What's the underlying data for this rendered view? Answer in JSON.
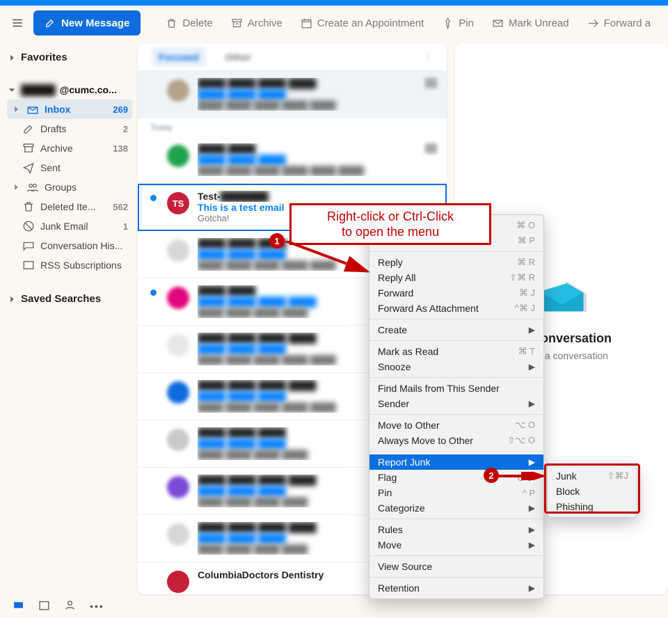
{
  "toolbar": {
    "new_message": "New Message",
    "buttons": [
      {
        "id": "delete",
        "label": "Delete"
      },
      {
        "id": "archive",
        "label": "Archive"
      },
      {
        "id": "appointment",
        "label": "Create an Appointment"
      },
      {
        "id": "pin",
        "label": "Pin"
      },
      {
        "id": "unread",
        "label": "Mark Unread"
      },
      {
        "id": "forward",
        "label": "Forward a"
      }
    ]
  },
  "sidebar": {
    "favorites": "Favorites",
    "saved_searches": "Saved Searches",
    "account": {
      "prefix_blur": "█████",
      "suffix": "@cumc.co..."
    },
    "folders": [
      {
        "id": "inbox",
        "label": "Inbox",
        "count": "269",
        "selected": true,
        "expandable": true
      },
      {
        "id": "drafts",
        "label": "Drafts",
        "count": "2"
      },
      {
        "id": "archive",
        "label": "Archive",
        "count": "138"
      },
      {
        "id": "sent",
        "label": "Sent"
      },
      {
        "id": "groups",
        "label": "Groups",
        "expandable": true
      },
      {
        "id": "deleted",
        "label": "Deleted Ite...",
        "count": "562"
      },
      {
        "id": "junk",
        "label": "Junk Email",
        "count": "1"
      },
      {
        "id": "convhist",
        "label": "Conversation His..."
      },
      {
        "id": "rss",
        "label": "RSS Subscriptions"
      }
    ]
  },
  "list_filters": {
    "active": "Focused",
    "other": "Other",
    "menu": "⋮"
  },
  "list_section_today": "Today",
  "selected_msg": {
    "avatar_initials": "TS",
    "from_prefix": "Test-",
    "from_blur": "███████",
    "subject": "This is a test email",
    "preview": "Gotcha!"
  },
  "last_visible_from": "ColumbiaDoctors Dentistry",
  "context_menu": {
    "top_items": [
      {
        "label": "",
        "shortcut": "⌘ O"
      },
      {
        "label": "",
        "shortcut": "⌘ P"
      }
    ],
    "reply": "Reply",
    "reply_sc": "⌘ R",
    "reply_all": "Reply All",
    "reply_all_sc": "⇧⌘ R",
    "forward": "Forward",
    "forward_sc": "⌘ J",
    "forward_attach": "Forward As Attachment",
    "forward_attach_sc": "^⌘ J",
    "create": "Create",
    "mark_read": "Mark as Read",
    "mark_read_sc": "⌘ T",
    "snooze": "Snooze",
    "find_sender": "Find Mails from This Sender",
    "sender": "Sender",
    "move_other": "Move to Other",
    "move_other_sc": "⌥ O",
    "always_move": "Always Move to Other",
    "always_move_sc": "⇧⌥ O",
    "report_junk": "Report Junk",
    "flag": "Flag",
    "flag_sc": "^ O",
    "pin": "Pin",
    "pin_sc": "^ P",
    "categorize": "Categorize",
    "rules": "Rules",
    "move": "Move",
    "view_source": "View Source",
    "retention": "Retention"
  },
  "submenu": {
    "junk": "Junk",
    "junk_sc": "⇧⌘J",
    "block": "Block",
    "phishing": "Phishing"
  },
  "reading": {
    "title": "No Conversation",
    "subtitle": "Select a conversation"
  },
  "annotation": {
    "line1": "Right-click or Ctrl-Click",
    "line2": "to open the menu",
    "badge1": "1",
    "badge2": "2"
  }
}
